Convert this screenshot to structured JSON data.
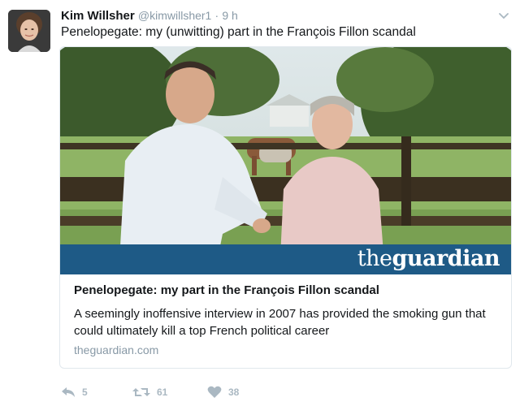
{
  "tweet": {
    "author_name": "Kim Willsher",
    "author_handle": "@kimwillsher1",
    "separator": "·",
    "time": "9 h",
    "text": "Penelopegate: my (unwitting) part in the François Fillon scandal"
  },
  "card": {
    "logo_prefix": "the",
    "logo_main": "guardian",
    "title": "Penelopegate: my part in the François Fillon scandal",
    "description": "A seemingly inoffensive interview in 2007 has provided the smoking gun that could ultimately kill a top French political career",
    "domain": "theguardian.com"
  },
  "actions": {
    "reply_count": "5",
    "retweet_count": "61",
    "like_count": "38"
  },
  "colors": {
    "guardian_blue": "#1e5a86",
    "muted": "#8899a6",
    "action_gray": "#aab8c2"
  },
  "icons": {
    "reply": "reply-icon",
    "retweet": "retweet-icon",
    "like": "heart-icon",
    "menu": "chevron-down-icon"
  }
}
